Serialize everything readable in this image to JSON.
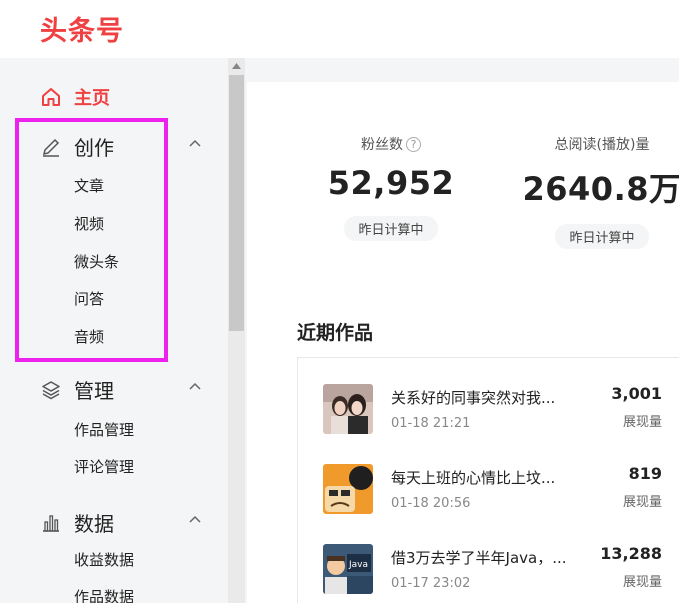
{
  "header": {
    "logo": "头条号"
  },
  "sidebar": {
    "home": "主页",
    "groups": [
      {
        "label": "创作",
        "items": [
          "文章",
          "视频",
          "微头条",
          "问答",
          "音频"
        ]
      },
      {
        "label": "管理",
        "items": [
          "作品管理",
          "评论管理"
        ]
      },
      {
        "label": "数据",
        "items": [
          "收益数据",
          "作品数据"
        ]
      }
    ]
  },
  "stats": [
    {
      "label": "粉丝数",
      "help": "?",
      "value": "52,952",
      "tag": "昨日计算中"
    },
    {
      "label": "总阅读(播放)量",
      "value": "2640.8万",
      "tag": "昨日计算中"
    }
  ],
  "recent": {
    "title": "近期作品",
    "items": [
      {
        "title": "关系好的同事突然对我...",
        "time": "01-18 21:21",
        "count": "3,001",
        "count_label": "展现量"
      },
      {
        "title": "每天上班的心情比上坟...",
        "time": "01-18 20:56",
        "count": "819",
        "count_label": "展现量"
      },
      {
        "title": "借3万去学了半年Java，...",
        "time": "01-17 23:02",
        "count": "13,288",
        "count_label": "展现量",
        "thumb_text": "Java"
      }
    ]
  },
  "colors": {
    "brand": "#f04142",
    "highlight": "#ee22ee"
  }
}
